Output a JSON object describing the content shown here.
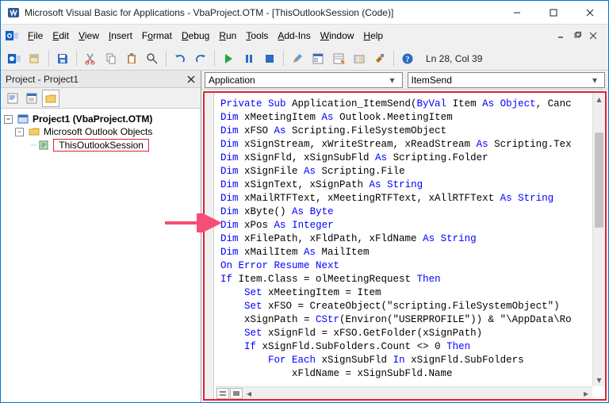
{
  "window": {
    "title": "Microsoft Visual Basic for Applications - VbaProject.OTM - [ThisOutlookSession (Code)]"
  },
  "menu": {
    "file": "File",
    "edit": "Edit",
    "view": "View",
    "insert": "Insert",
    "format": "Format",
    "debug": "Debug",
    "run": "Run",
    "tools": "Tools",
    "addins": "Add-Ins",
    "window": "Window",
    "help": "Help"
  },
  "status": {
    "cursor": "Ln 28, Col 39"
  },
  "project": {
    "panel_title": "Project - Project1",
    "root": "Project1 (VbaProject.OTM)",
    "folder": "Microsoft Outlook Objects",
    "leaf": "ThisOutlookSession"
  },
  "combos": {
    "left": "Application",
    "right": "ItemSend"
  },
  "code_lines": [
    {
      "segments": [
        {
          "t": "Private Sub",
          "c": "kw"
        },
        {
          "t": " Application_ItemSend("
        },
        {
          "t": "ByVal",
          "c": "kw"
        },
        {
          "t": " Item "
        },
        {
          "t": "As",
          "c": "kw"
        },
        {
          "t": " "
        },
        {
          "t": "Object",
          "c": "kw"
        },
        {
          "t": ", Canc"
        }
      ]
    },
    {
      "segments": [
        {
          "t": "Dim",
          "c": "kw"
        },
        {
          "t": " xMeetingItem "
        },
        {
          "t": "As",
          "c": "kw"
        },
        {
          "t": " Outlook.MeetingItem"
        }
      ]
    },
    {
      "segments": [
        {
          "t": "Dim",
          "c": "kw"
        },
        {
          "t": " xFSO "
        },
        {
          "t": "As",
          "c": "kw"
        },
        {
          "t": " Scripting.FileSystemObject"
        }
      ]
    },
    {
      "segments": [
        {
          "t": "Dim",
          "c": "kw"
        },
        {
          "t": " xSignStream, xWriteStream, xReadStream "
        },
        {
          "t": "As",
          "c": "kw"
        },
        {
          "t": " Scripting.Tex"
        }
      ]
    },
    {
      "segments": [
        {
          "t": "Dim",
          "c": "kw"
        },
        {
          "t": " xSignFld, xSignSubFld "
        },
        {
          "t": "As",
          "c": "kw"
        },
        {
          "t": " Scripting.Folder"
        }
      ]
    },
    {
      "segments": [
        {
          "t": "Dim",
          "c": "kw"
        },
        {
          "t": " xSignFile "
        },
        {
          "t": "As",
          "c": "kw"
        },
        {
          "t": " Scripting.File"
        }
      ]
    },
    {
      "segments": [
        {
          "t": "Dim",
          "c": "kw"
        },
        {
          "t": " xSignText, xSignPath "
        },
        {
          "t": "As",
          "c": "kw"
        },
        {
          "t": " "
        },
        {
          "t": "String",
          "c": "kw"
        }
      ]
    },
    {
      "segments": [
        {
          "t": "Dim",
          "c": "kw"
        },
        {
          "t": " xMailRTFText, xMeetingRTFText, xAllRTFText "
        },
        {
          "t": "As",
          "c": "kw"
        },
        {
          "t": " "
        },
        {
          "t": "String",
          "c": "kw"
        }
      ]
    },
    {
      "segments": [
        {
          "t": "Dim",
          "c": "kw"
        },
        {
          "t": " xByte() "
        },
        {
          "t": "As",
          "c": "kw"
        },
        {
          "t": " "
        },
        {
          "t": "Byte",
          "c": "kw"
        }
      ]
    },
    {
      "segments": [
        {
          "t": "Dim",
          "c": "kw"
        },
        {
          "t": " xPos "
        },
        {
          "t": "As",
          "c": "kw"
        },
        {
          "t": " "
        },
        {
          "t": "Integer",
          "c": "kw"
        }
      ]
    },
    {
      "segments": [
        {
          "t": "Dim",
          "c": "kw"
        },
        {
          "t": " xFilePath, xFldPath, xFldName "
        },
        {
          "t": "As",
          "c": "kw"
        },
        {
          "t": " "
        },
        {
          "t": "String",
          "c": "kw"
        }
      ]
    },
    {
      "segments": [
        {
          "t": "Dim",
          "c": "kw"
        },
        {
          "t": " xMailItem "
        },
        {
          "t": "As",
          "c": "kw"
        },
        {
          "t": " MailItem"
        }
      ]
    },
    {
      "segments": [
        {
          "t": "On Error Resume Next",
          "c": "kw"
        }
      ]
    },
    {
      "segments": [
        {
          "t": "If",
          "c": "kw"
        },
        {
          "t": " Item.Class = olMeetingRequest "
        },
        {
          "t": "Then",
          "c": "kw"
        }
      ]
    },
    {
      "segments": [
        {
          "t": "    "
        },
        {
          "t": "Set",
          "c": "kw"
        },
        {
          "t": " xMeetingItem = Item"
        }
      ]
    },
    {
      "segments": [
        {
          "t": "    "
        },
        {
          "t": "Set",
          "c": "kw"
        },
        {
          "t": " xFSO = CreateObject(\"scripting.FileSystemObject\")"
        }
      ]
    },
    {
      "segments": [
        {
          "t": "    xSignPath = "
        },
        {
          "t": "CStr",
          "c": "kw"
        },
        {
          "t": "(Environ(\"USERPROFILE\")) & \"\\AppData\\Ro"
        }
      ]
    },
    {
      "segments": [
        {
          "t": "    "
        },
        {
          "t": "Set",
          "c": "kw"
        },
        {
          "t": " xSignFld = xFSO.GetFolder(xSignPath)"
        }
      ]
    },
    {
      "segments": [
        {
          "t": "    "
        },
        {
          "t": "If",
          "c": "kw"
        },
        {
          "t": " xSignFld.SubFolders.Count <> 0 "
        },
        {
          "t": "Then",
          "c": "kw"
        }
      ]
    },
    {
      "segments": [
        {
          "t": "        "
        },
        {
          "t": "For Each",
          "c": "kw"
        },
        {
          "t": " xSignSubFld "
        },
        {
          "t": "In",
          "c": "kw"
        },
        {
          "t": " xSignFld.SubFolders"
        }
      ]
    },
    {
      "segments": [
        {
          "t": "            xFldName = xSignSubFld.Name"
        }
      ]
    }
  ]
}
